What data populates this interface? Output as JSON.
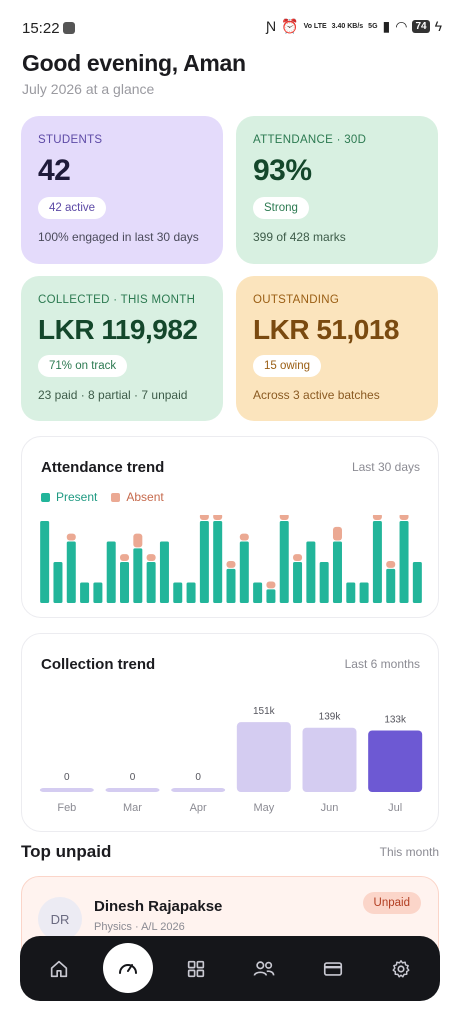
{
  "status_bar": {
    "time": "15:22",
    "volte": "Vo LTE",
    "speed": "3.40 KB/s",
    "network": "5G",
    "battery": "74"
  },
  "header": {
    "greeting": "Good evening, Aman",
    "subtitle": "July 2026 at a glance"
  },
  "stats": {
    "students": {
      "label": "STUDENTS",
      "value": "42",
      "pill": "42 active",
      "foot": "100% engaged in last 30 days"
    },
    "attendance": {
      "label": "ATTENDANCE · 30D",
      "value": "93%",
      "pill": "Strong",
      "foot": "399 of 428 marks"
    },
    "collected": {
      "label": "COLLECTED · THIS MONTH",
      "value": "LKR 119,982",
      "pill": "71% on track",
      "foot": "23 paid · 8 partial · 7 unpaid"
    },
    "outstanding": {
      "label": "OUTSTANDING",
      "value": "LKR 51,018",
      "pill": "15 owing",
      "foot": "Across 3 active batches"
    }
  },
  "attendance_trend": {
    "title": "Attendance trend",
    "range": "Last 30 days",
    "legend_present": "Present",
    "legend_absent": "Absent"
  },
  "collection_trend": {
    "title": "Collection trend",
    "range": "Last 6 months"
  },
  "top_unpaid": {
    "title": "Top unpaid",
    "range": "This month",
    "items": [
      {
        "initials": "DR",
        "name": "Dinesh Rajapakse",
        "sub": "Physics · A/L 2026",
        "status": "Unpaid"
      }
    ]
  },
  "nav": {
    "items": [
      "home-icon",
      "dashboard-gauge-icon",
      "grid-icon",
      "people-icon",
      "card-icon",
      "gear-icon"
    ],
    "active_index": 1
  },
  "colors": {
    "present": "#22b59a",
    "absent": "#eba993",
    "collection_light": "#d4ccf1",
    "collection_current": "#6d59d3"
  },
  "chart_data": [
    {
      "type": "bar",
      "stacked": true,
      "title": "Attendance trend",
      "subtitle": "Last 30 days",
      "legend_placement": "top-left",
      "grid": false,
      "ylim": [
        0,
        12
      ],
      "series": [
        {
          "name": "Present",
          "values": [
            12,
            6,
            9,
            3,
            3,
            9,
            6,
            8,
            6,
            9,
            3,
            3,
            12,
            12,
            5,
            9,
            3,
            2,
            12,
            6,
            9,
            6,
            9,
            3,
            3,
            12,
            5,
            12,
            6
          ]
        },
        {
          "name": "Absent",
          "values": [
            0,
            0,
            1,
            0,
            0,
            0,
            1,
            2,
            1,
            0,
            0,
            0,
            1,
            1,
            1,
            1,
            0,
            1,
            1,
            1,
            0,
            0,
            2,
            0,
            0,
            1,
            1,
            1,
            0
          ]
        }
      ]
    },
    {
      "type": "bar",
      "title": "Collection trend",
      "subtitle": "Last 6 months",
      "categories": [
        "Feb",
        "Mar",
        "Apr",
        "May",
        "Jun",
        "Jul"
      ],
      "values": [
        0,
        0,
        0,
        151,
        139,
        133
      ],
      "data_labels": [
        "0",
        "0",
        "0",
        "151k",
        "139k",
        "133k"
      ],
      "unit": "k",
      "ylim": [
        0,
        160
      ],
      "highlight_index": 5,
      "grid": false
    }
  ]
}
